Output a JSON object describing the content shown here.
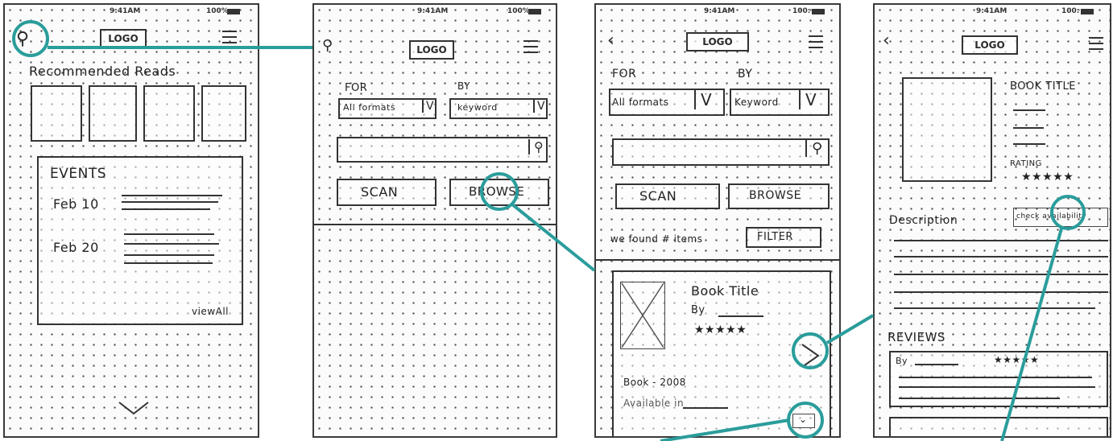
{
  "status": {
    "time": "9:41AM",
    "battery_p1": "100%",
    "battery_p2": "100%",
    "battery_p3": "100:",
    "battery_p4": "100:"
  },
  "logo": {
    "p1": "LOGO",
    "p2": "LOGO",
    "p3": "LOGO",
    "p4": "LOGO"
  },
  "screen1": {
    "title": "Recommended Reads",
    "events_title": "EVENTS",
    "event1": "Feb 10",
    "event2": "Feb 20",
    "view_all": "viewAll"
  },
  "screen2": {
    "for_label": "FOR",
    "by_label": "BY",
    "for_value": "All formats",
    "by_value": "keyword",
    "scan": "SCAN",
    "browse": "BROWSE"
  },
  "screen3": {
    "for_label": "FOR",
    "by_label": "BY",
    "for_value": "All formats",
    "by_value": "Keyword",
    "scan": "SCAN",
    "browse": "BROWSE",
    "found": "we found # items",
    "filter": "FILTER",
    "book_title": "Book Title",
    "by": "By",
    "stars": "★★★★★",
    "book_year": "Book - 2008",
    "available": "Available in"
  },
  "screen4": {
    "book_title": "BOOK TITLE",
    "rating_label": "RATING",
    "stars": "★★★★★",
    "check": "check availability",
    "description": "Description",
    "reviews": "REVIEWS",
    "review_by": "By",
    "review_stars": "★★★★★"
  },
  "colors": {
    "accent": "#2a9d9b",
    "ink": "#2a2a2a"
  }
}
